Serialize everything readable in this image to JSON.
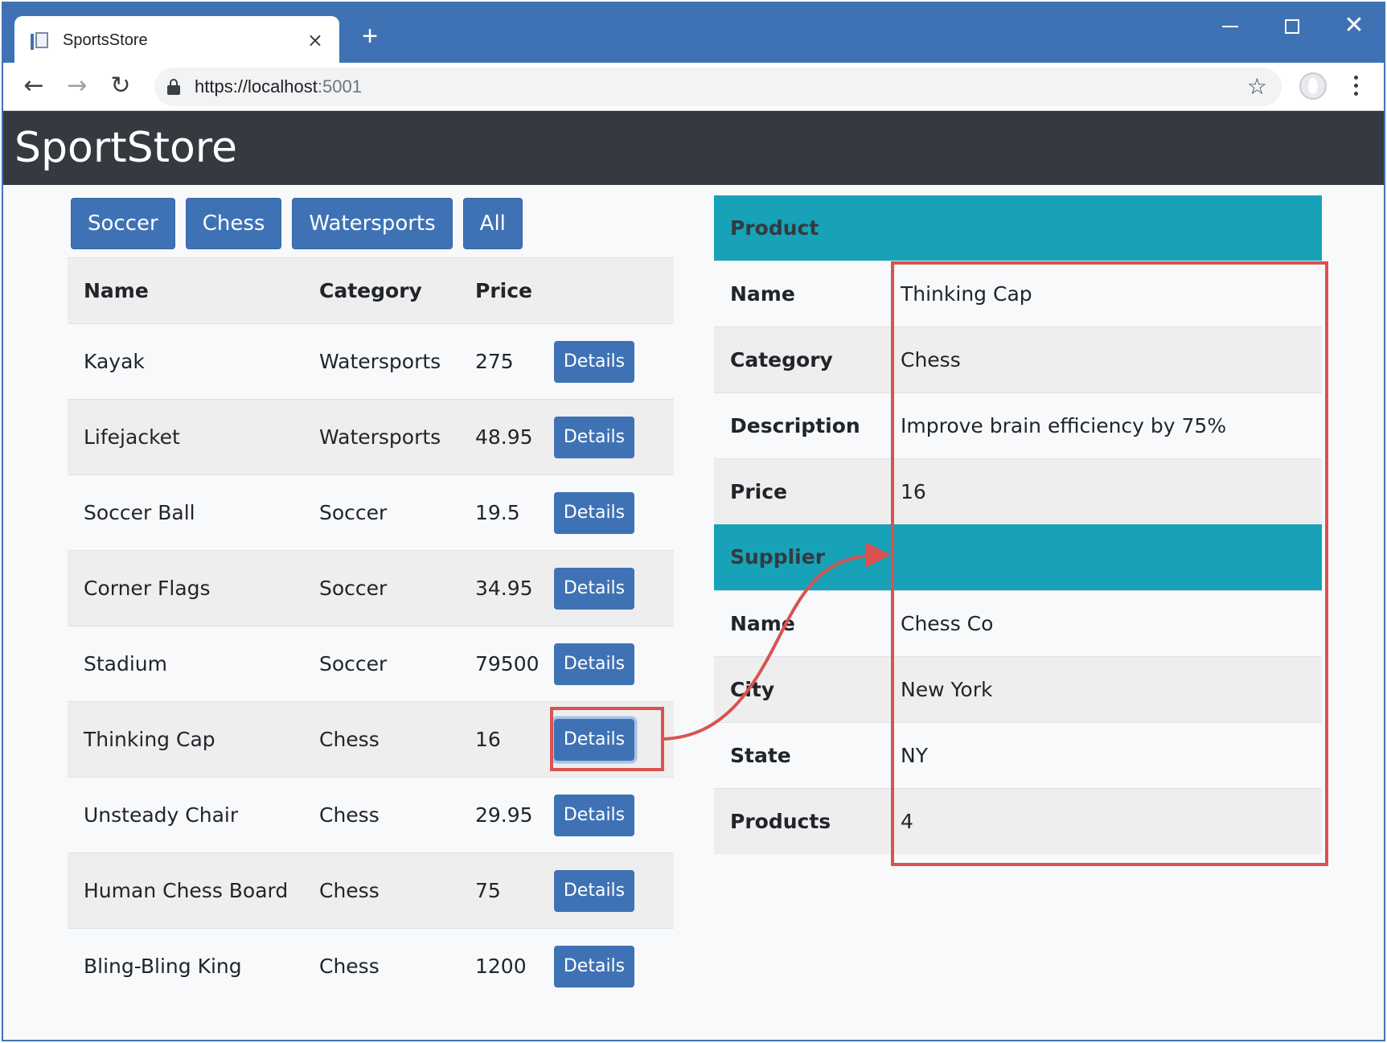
{
  "browser": {
    "tab_title": "SportsStore",
    "tab_close": "×",
    "new_tab": "+",
    "url_scheme_host": "https://localhost",
    "url_port": ":5001",
    "close_glyph": "✕",
    "back_glyph": "←",
    "forward_glyph": "→",
    "reload_glyph": "↻",
    "star_glyph": "☆"
  },
  "app": {
    "title": "SportStore"
  },
  "categories": [
    "Soccer",
    "Chess",
    "Watersports",
    "All"
  ],
  "products_table": {
    "headers": [
      "Name",
      "Category",
      "Price"
    ],
    "button_label": "Details",
    "rows": [
      {
        "name": "Kayak",
        "category": "Watersports",
        "price": "275"
      },
      {
        "name": "Lifejacket",
        "category": "Watersports",
        "price": "48.95"
      },
      {
        "name": "Soccer Ball",
        "category": "Soccer",
        "price": "19.5"
      },
      {
        "name": "Corner Flags",
        "category": "Soccer",
        "price": "34.95"
      },
      {
        "name": "Stadium",
        "category": "Soccer",
        "price": "79500"
      },
      {
        "name": "Thinking Cap",
        "category": "Chess",
        "price": "16"
      },
      {
        "name": "Unsteady Chair",
        "category": "Chess",
        "price": "29.95"
      },
      {
        "name": "Human Chess Board",
        "category": "Chess",
        "price": "75"
      },
      {
        "name": "Bling-Bling King",
        "category": "Chess",
        "price": "1200"
      }
    ],
    "selected_row": 5
  },
  "detail": {
    "product_header": "Product",
    "product": [
      {
        "label": "Name",
        "value": "Thinking Cap"
      },
      {
        "label": "Category",
        "value": "Chess"
      },
      {
        "label": "Description",
        "value": "Improve brain efficiency by 75%"
      },
      {
        "label": "Price",
        "value": "16"
      }
    ],
    "supplier_header": "Supplier",
    "supplier": [
      {
        "label": "Name",
        "value": "Chess Co"
      },
      {
        "label": "City",
        "value": "New York"
      },
      {
        "label": "State",
        "value": "NY"
      },
      {
        "label": "Products",
        "value": "4"
      }
    ]
  },
  "colors": {
    "titlebar": "#3f72b5",
    "header": "#343a40",
    "primary": "#3f72b5",
    "info": "#17a2b8",
    "annotation": "#d9534f"
  }
}
